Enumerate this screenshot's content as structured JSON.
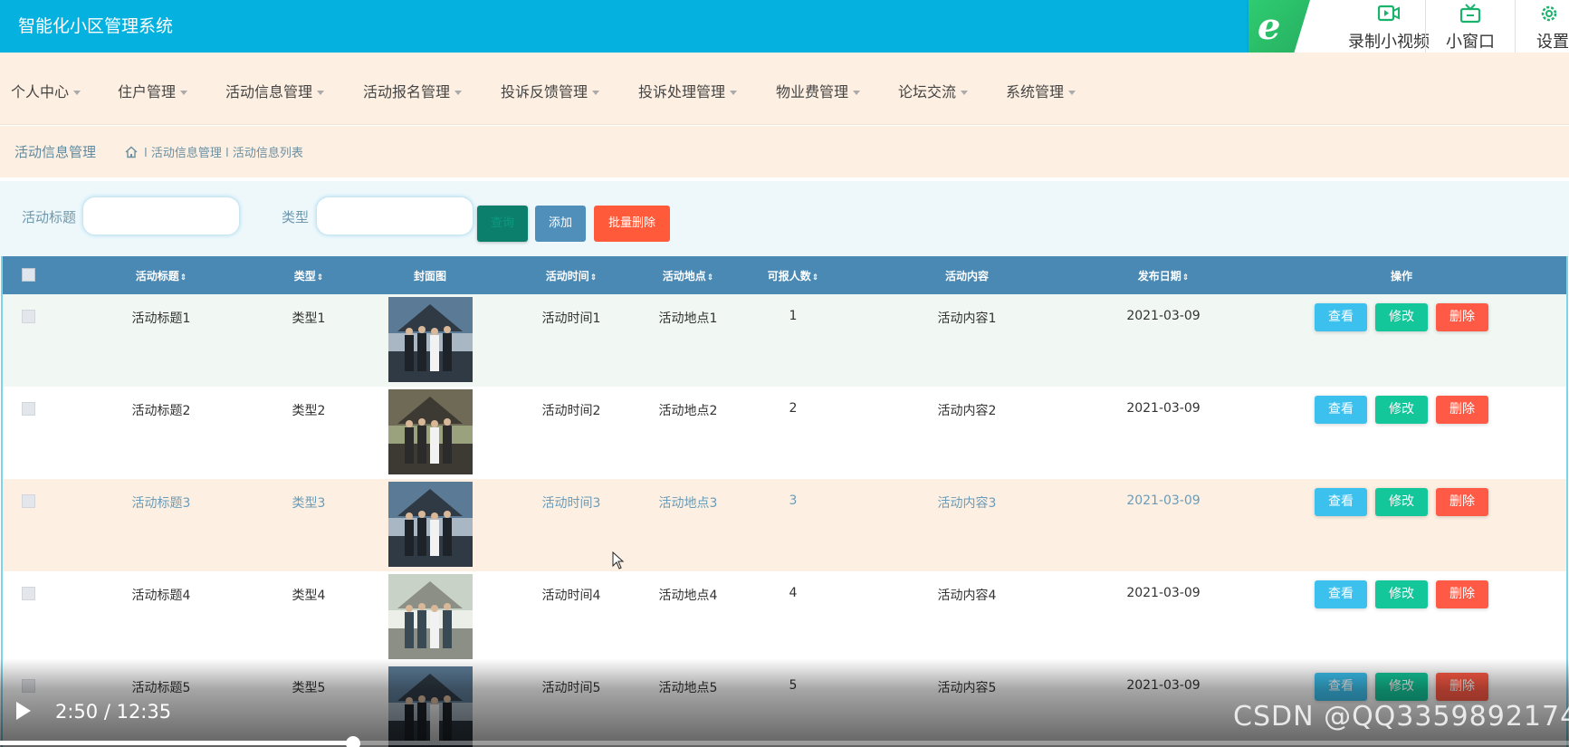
{
  "header": {
    "title": "智能化小区管理系统",
    "brand_color": "#05b1de"
  },
  "browser_extension": {
    "logo_icon": "ie-e-icon",
    "items": [
      {
        "icon": "video-record-icon",
        "label": "录制小视频"
      },
      {
        "icon": "mini-window-icon",
        "label": "小窗口"
      },
      {
        "icon": "gear-icon",
        "label": "设置"
      }
    ]
  },
  "nav": {
    "items": [
      {
        "label": "个人中心"
      },
      {
        "label": "住户管理"
      },
      {
        "label": "活动信息管理"
      },
      {
        "label": "活动报名管理"
      },
      {
        "label": "投诉反馈管理"
      },
      {
        "label": "投诉处理管理"
      },
      {
        "label": "物业费管理"
      },
      {
        "label": "论坛交流"
      },
      {
        "label": "系统管理"
      }
    ]
  },
  "breadcrumb": {
    "title": "活动信息管理",
    "separator": "l",
    "path": [
      "活动信息管理",
      "活动信息列表"
    ]
  },
  "search": {
    "title_label": "活动标题",
    "title_value": "",
    "type_label": "类型",
    "type_value": "",
    "query_button": "查询",
    "add_button": "添加",
    "batch_delete_button": "批量删除"
  },
  "table": {
    "columns": [
      "活动标题",
      "类型",
      "封面图",
      "活动时间",
      "活动地点",
      "可报人数",
      "活动内容",
      "发布日期",
      "操作"
    ],
    "sortable": [
      true,
      true,
      false,
      true,
      true,
      true,
      false,
      true,
      false
    ],
    "sort_glyph": "⇕",
    "rows": [
      {
        "title": "活动标题1",
        "type": "类型1",
        "time": "活动时间1",
        "place": "活动地点1",
        "capacity": "1",
        "content": "活动内容1",
        "date": "2021-03-09",
        "highlighted": false,
        "bg": "#f1f7f2"
      },
      {
        "title": "活动标题2",
        "type": "类型2",
        "time": "活动时间2",
        "place": "活动地点2",
        "capacity": "2",
        "content": "活动内容2",
        "date": "2021-03-09",
        "highlighted": false,
        "bg": "#ffffff"
      },
      {
        "title": "活动标题3",
        "type": "类型3",
        "time": "活动时间3",
        "place": "活动地点3",
        "capacity": "3",
        "content": "活动内容3",
        "date": "2021-03-09",
        "highlighted": true,
        "bg": "#fdf0e2"
      },
      {
        "title": "活动标题4",
        "type": "类型4",
        "time": "活动时间4",
        "place": "活动地点4",
        "capacity": "4",
        "content": "活动内容4",
        "date": "2021-03-09",
        "highlighted": false,
        "bg": "#ffffff"
      },
      {
        "title": "活动标题5",
        "type": "类型5",
        "time": "活动时间5",
        "place": "活动地点5",
        "capacity": "5",
        "content": "活动内容5",
        "date": "2021-03-09",
        "highlighted": false,
        "bg": "#ffffff"
      }
    ],
    "actions": {
      "view": "查看",
      "edit": "修改",
      "delete": "删除"
    }
  },
  "video_player": {
    "time": "2:50 / 12:35",
    "progress": 0.225
  },
  "watermark": "CSDN @QQ3359892174"
}
